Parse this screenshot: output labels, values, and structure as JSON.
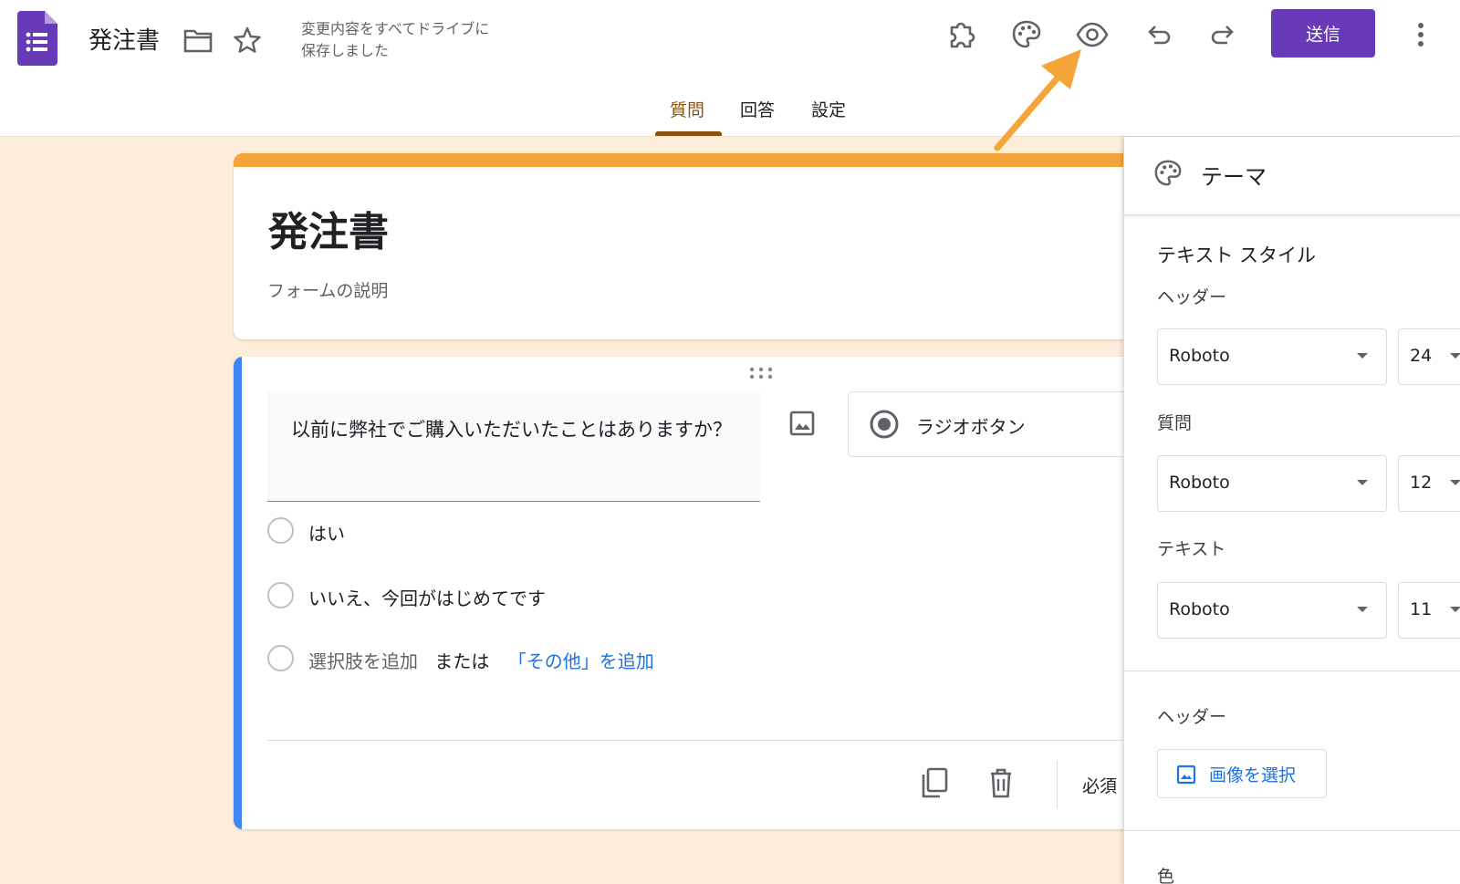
{
  "header": {
    "doc_title": "発注書",
    "save_status_line1": "変更内容をすべてドライブに",
    "save_status_line2": "保存しました",
    "send_label": "送信",
    "icons": [
      "forms-logo-icon",
      "folder-icon",
      "star-icon",
      "addon-puzzle-icon",
      "palette-icon",
      "eye-preview-icon",
      "undo-icon",
      "redo-icon",
      "more-vert-icon"
    ]
  },
  "tabs": [
    {
      "label": "質問",
      "active": true
    },
    {
      "label": "回答",
      "active": false
    },
    {
      "label": "設定",
      "active": false
    }
  ],
  "form": {
    "title": "発注書",
    "description": "フォームの説明",
    "question": {
      "text": "以前に弊社でご購入いただいたことはありますか？",
      "type_label": "ラジオボタン",
      "options": [
        "はい",
        "いいえ、今回がはじめてです"
      ],
      "add_option": "選択肢を追加",
      "or": "または",
      "add_other": "「その他」を追加",
      "required_label": "必須"
    }
  },
  "theme_panel": {
    "title": "テーマ",
    "text_style_title": "テキスト スタイル",
    "header_label": "ヘッダー",
    "header_font": "Roboto",
    "header_size": "24",
    "question_label": "質問",
    "question_font": "Roboto",
    "question_size": "12",
    "text_label": "テキスト",
    "text_font": "Roboto",
    "text_size": "11",
    "header_image_title": "ヘッダー",
    "select_image_label": "画像を選択",
    "color_title": "色"
  },
  "colors": {
    "accent_purple": "#673ab7",
    "form_accent": "#f4a53a",
    "background": "#fdeedb",
    "question_bar": "#4285f4",
    "active_tab": "#8a5211",
    "annotation_arrow": "#f4a53a"
  }
}
